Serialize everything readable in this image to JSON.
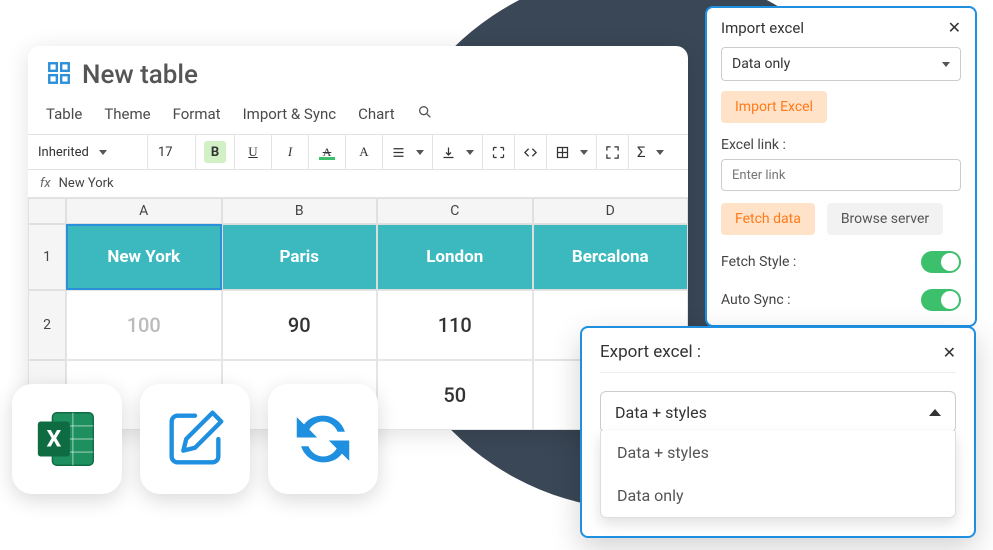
{
  "app": {
    "title": "New table"
  },
  "menu": {
    "table": "Table",
    "theme": "Theme",
    "format": "Format",
    "import": "Import & Sync",
    "chart": "Chart"
  },
  "toolbar": {
    "font": "Inherited",
    "size": "17",
    "bold": "B",
    "underline": "U",
    "italic": "I",
    "strike": "A",
    "textcolor": "A"
  },
  "fx": {
    "label": "fx",
    "value": "New York"
  },
  "columns": {
    "a": "A",
    "b": "B",
    "c": "C",
    "d": "D"
  },
  "rows": {
    "r1": "1",
    "r2": "2"
  },
  "headers": {
    "a": "New York",
    "b": "Paris",
    "c": "London",
    "d": "Bercalona"
  },
  "row2": {
    "a": "100",
    "b": "90",
    "c": "110",
    "d": ""
  },
  "row3": {
    "c": "50"
  },
  "import": {
    "title": "Import excel",
    "mode": "Data only",
    "btn": "Import Excel",
    "link_label": "Excel link :",
    "link_placeholder": "Enter link",
    "fetch_btn": "Fetch data",
    "browse_btn": "Browse server",
    "fetch_style": "Fetch Style :",
    "auto_sync": "Auto Sync :"
  },
  "export": {
    "title": "Export excel :",
    "selected": "Data + styles",
    "opt1": "Data + styles",
    "opt2": "Data only"
  }
}
